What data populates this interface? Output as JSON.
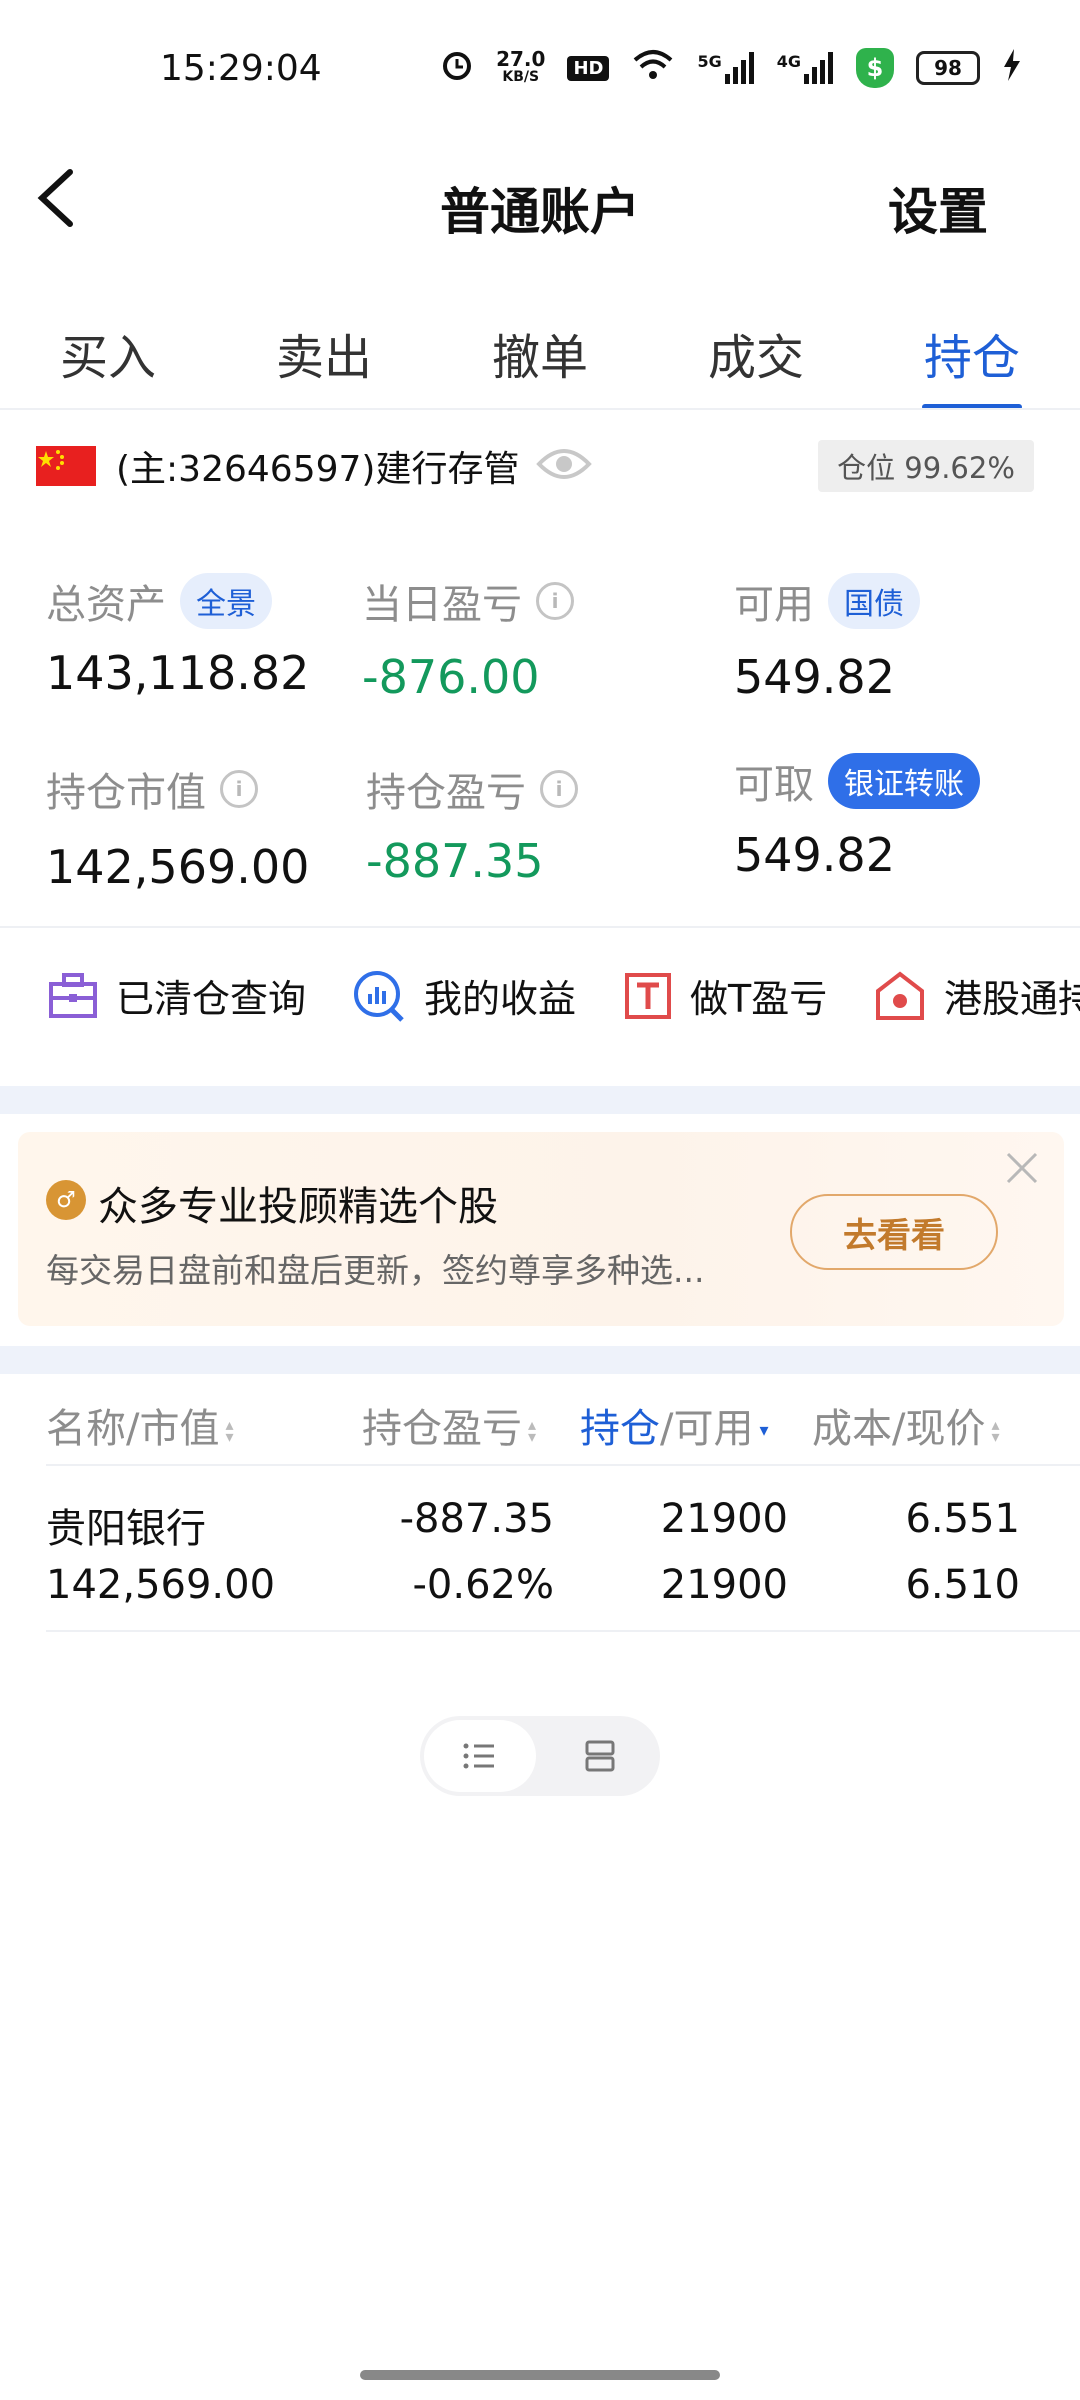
{
  "status_bar": {
    "time": "15:29:04",
    "speed": "27.0",
    "speed_unit": "KB/S",
    "hd": "HD",
    "net5g": "5G",
    "net4g": "4G",
    "battery": "98"
  },
  "header": {
    "title": "普通账户",
    "settings": "设置"
  },
  "tabs": [
    {
      "label": "买入",
      "active": false
    },
    {
      "label": "卖出",
      "active": false
    },
    {
      "label": "撤单",
      "active": false
    },
    {
      "label": "成交",
      "active": false
    },
    {
      "label": "持仓",
      "active": true
    }
  ],
  "account": {
    "id": "(主:32646597)建行存管",
    "position_ratio": "仓位 99.62%"
  },
  "metrics": {
    "total_assets": {
      "label": "总资产",
      "badge": "全景",
      "value": "143,118.82"
    },
    "daily_pnl": {
      "label": "当日盈亏",
      "value": "-876.00"
    },
    "available": {
      "label": "可用",
      "badge": "国债",
      "value": "549.82"
    },
    "market_value": {
      "label": "持仓市值",
      "value": "142,569.00"
    },
    "position_pnl": {
      "label": "持仓盈亏",
      "value": "-887.35"
    },
    "withdrawable": {
      "label": "可取",
      "badge": "银证转账",
      "value": "549.82"
    }
  },
  "shortcuts": [
    {
      "label": "已清仓查询",
      "icon": "briefcase-icon"
    },
    {
      "label": "我的收益",
      "icon": "chart-search-icon"
    },
    {
      "label": "做T盈亏",
      "icon": "t-box-icon"
    },
    {
      "label": "港股通持",
      "icon": "hk-house-icon"
    }
  ],
  "promo": {
    "icon_text": "♂",
    "title": "众多专业投顾精选个股",
    "subtitle": "每交易日盘前和盘后更新，签约尊享多种选...",
    "button": "去看看"
  },
  "table": {
    "headers": {
      "name": "名称/市值",
      "pnl": "持仓盈亏",
      "hold": "持仓",
      "avail": "/可用",
      "cost": "成本/现价"
    },
    "rows": [
      {
        "name": "贵阳银行",
        "market_value": "142,569.00",
        "pnl": "-887.35",
        "pnl_pct": "-0.62%",
        "hold": "21900",
        "available": "21900",
        "cost": "6.551",
        "price": "6.510"
      }
    ]
  },
  "colors": {
    "accent": "#1e5fd6",
    "loss_green": "#13995c",
    "promo_orange": "#c27a2c"
  }
}
